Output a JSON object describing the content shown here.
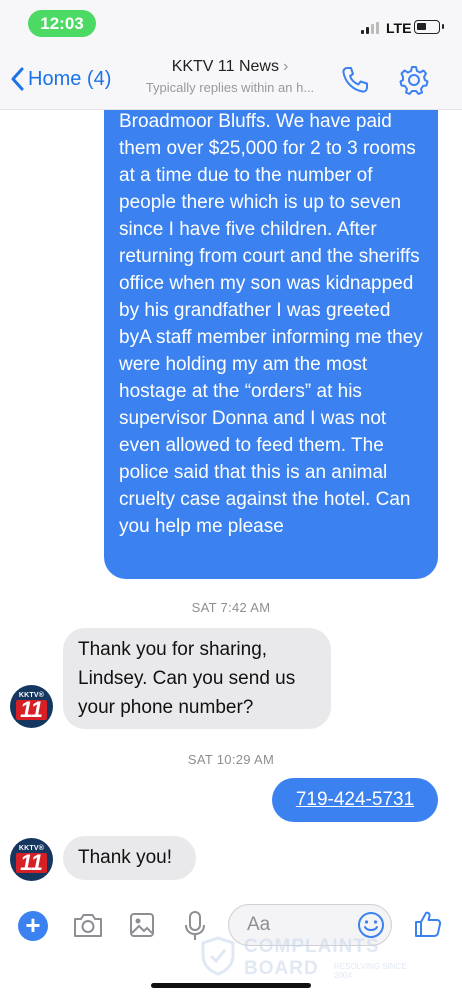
{
  "status_bar": {
    "time": "12:03",
    "network": "LTE"
  },
  "header": {
    "back_label": "Home (4)",
    "title": "KKTV 11 News",
    "subtitle": "Typically replies within an h..."
  },
  "messages": {
    "outgoing_1": "Broadmoor Bluffs. We have paid them over $25,000 for 2 to 3 rooms at a time due to the number of people there which is up to seven since I have five children. After returning from court and the sheriffs office when my son was kidnapped by his grandfather I was greeted byA staff member informing me they were holding my am the most hostage at the “orders” at his supervisor Donna and I was not even allowed to feed them. The police said that this is an animal cruelty case against the hotel. Can you help me please",
    "timestamp_1": "SAT 7:42 AM",
    "incoming_1": "Thank you for sharing, Lindsey. Can you send us your phone number?",
    "timestamp_2": "SAT 10:29 AM",
    "outgoing_phone": "719-424-5731",
    "incoming_2": "Thank you!"
  },
  "avatar": {
    "brand": "KKTV®",
    "number": "11"
  },
  "composer": {
    "placeholder": "Aa"
  },
  "watermark": {
    "line1": "COMPLAINTS",
    "line2": "BOARD",
    "tagline": "RESOLVING SINCE 2004"
  },
  "colors": {
    "accent": "#3b82f0",
    "bubble_in": "#e9e9eb",
    "time_pill": "#4cd964"
  }
}
